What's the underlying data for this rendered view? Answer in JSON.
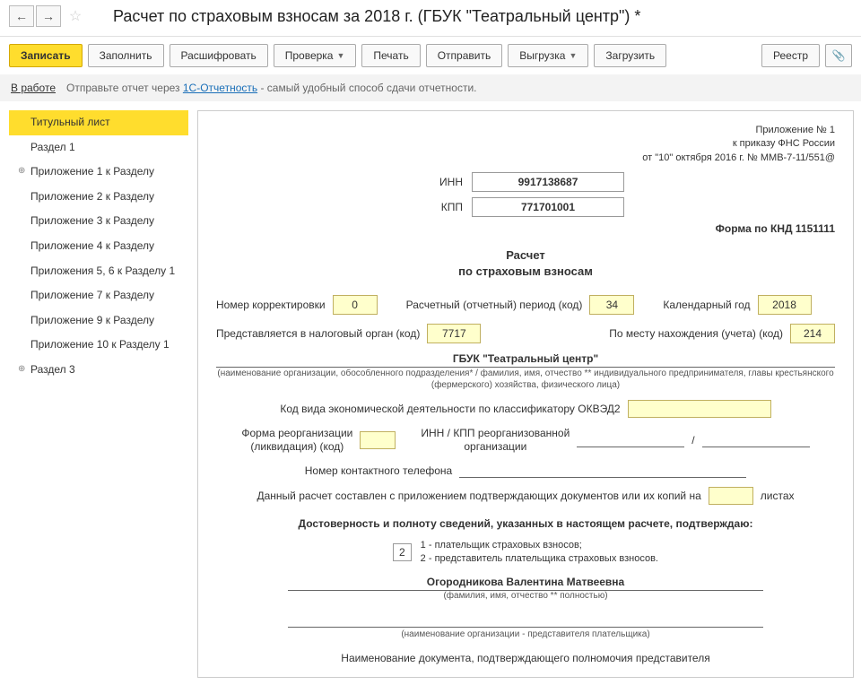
{
  "header": {
    "title": "Расчет по страховым взносам за 2018 г. (ГБУК \"Театральный центр\") *"
  },
  "toolbar": {
    "save": "Записать",
    "fill": "Заполнить",
    "decode": "Расшифровать",
    "check": "Проверка",
    "print": "Печать",
    "send": "Отправить",
    "export": "Выгрузка",
    "import": "Загрузить",
    "registry": "Реестр"
  },
  "status": {
    "in_work": "В работе",
    "prefix": "Отправьте отчет через",
    "link": "1С-Отчетность",
    "suffix": "- самый удобный способ сдачи отчетности."
  },
  "sidebar": [
    {
      "label": "Титульный лист",
      "active": true,
      "expand": ""
    },
    {
      "label": "Раздел 1",
      "expand": ""
    },
    {
      "label": "Приложение 1 к Разделу",
      "expand": "⊕"
    },
    {
      "label": "Приложение 2 к Разделу",
      "expand": ""
    },
    {
      "label": "Приложение 3 к Разделу",
      "expand": ""
    },
    {
      "label": "Приложение 4 к Разделу",
      "expand": ""
    },
    {
      "label": "Приложения 5, 6 к Разделу 1",
      "expand": ""
    },
    {
      "label": "Приложение 7 к Разделу",
      "expand": ""
    },
    {
      "label": "Приложение 9 к Разделу",
      "expand": ""
    },
    {
      "label": "Приложение 10 к Разделу 1",
      "expand": ""
    },
    {
      "label": "Раздел 3",
      "expand": "⊕"
    }
  ],
  "form": {
    "app_header1": "Приложение № 1",
    "app_header2": "к приказу ФНС России",
    "app_header3": "от \"10\" октября 2016 г. № ММВ-7-11/551@",
    "inn_label": "ИНН",
    "inn": "9917138687",
    "kpp_label": "КПП",
    "kpp": "771701001",
    "knd": "Форма по КНД 1151111",
    "title1": "Расчет",
    "title2": "по страховым взносам",
    "corr_label": "Номер корректировки",
    "corr": "0",
    "period_label": "Расчетный (отчетный) период (код)",
    "period": "34",
    "year_label": "Календарный год",
    "year": "2018",
    "tax_label": "Представляется в налоговый орган (код)",
    "tax": "7717",
    "loc_label": "По месту нахождения (учета) (код)",
    "loc": "214",
    "org": "ГБУК \"Театральный центр\"",
    "org_hint": "(наименование организации, обособленного подразделения* / фамилия, имя, отчество ** индивидуального предпринимателя, главы крестьянского (фермерского) хозяйства, физического лица)",
    "okved_label": "Код вида экономической деятельности по классификатору ОКВЭД2",
    "reorg_label1": "Форма реорганизации",
    "reorg_label2": "(ликвидация) (код)",
    "reorg_inn_label1": "ИНН / КПП реорганизованной",
    "reorg_inn_label2": "организации",
    "slash": "/",
    "phone_label": "Номер контактного телефона",
    "attach_prefix": "Данный расчет составлен с приложением подтверждающих документов или их копий на",
    "attach_suffix": "листах",
    "confirm_title": "Достоверность и полноту сведений, указанных в настоящем расчете, подтверждаю:",
    "conf_code": "2",
    "conf_text1": "1 - плательщик страховых взносов;",
    "conf_text2": "2 - представитель плательщика страховых взносов.",
    "person": "Огородникова Валентина Матвеевна",
    "person_hint": "(фамилия, имя, отчество ** полностью)",
    "rep_hint": "(наименование организации - представителя плательщика)",
    "doc_label": "Наименование документа, подтверждающего полномочия представителя"
  }
}
